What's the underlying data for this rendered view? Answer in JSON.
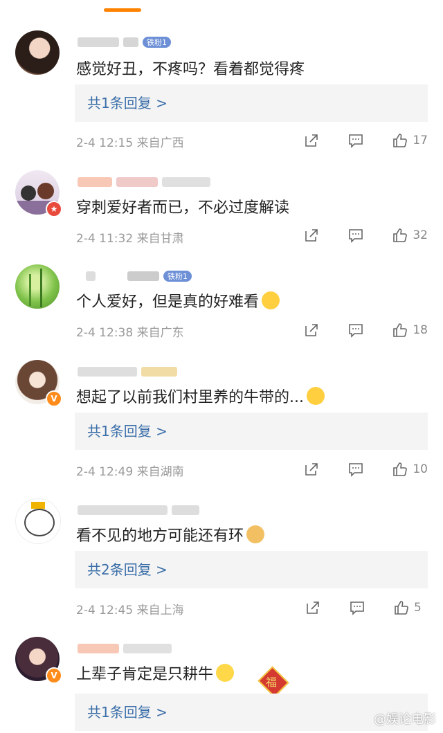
{
  "fan_badge": "铁粉1",
  "comments": [
    {
      "text": "感觉好丑，不疼吗？看着都觉得疼",
      "reply": "共1条回复 >",
      "time": "2-4 12:15",
      "location": "来自广西",
      "likes": "17"
    },
    {
      "text": "穿刺爱好者而已，不必过度解读",
      "time": "2-4 11:32",
      "location": "来自甘肃",
      "likes": "32"
    },
    {
      "text": "个人爱好，但是真的好难看",
      "time": "2-4 12:38",
      "location": "来自广东",
      "likes": "18"
    },
    {
      "text": "想起了以前我们村里养的牛带的...",
      "reply": "共1条回复 >",
      "time": "2-4 12:49",
      "location": "来自湖南",
      "likes": "10"
    },
    {
      "text": "看不见的地方可能还有环",
      "reply": "共2条回复 >",
      "time": "2-4 12:45",
      "location": "来自上海",
      "likes": "5"
    },
    {
      "text": "上辈子肯定是只耕牛",
      "reply": "共1条回复 >"
    }
  ],
  "stamp_char": "福",
  "watermark": "@娱论电影",
  "colors": {
    "accent": "#ff8200",
    "link": "#3a6ea8",
    "meta": "#999999",
    "reply_bg": "#f4f4f4",
    "fan_badge": "#6c8fd6"
  }
}
